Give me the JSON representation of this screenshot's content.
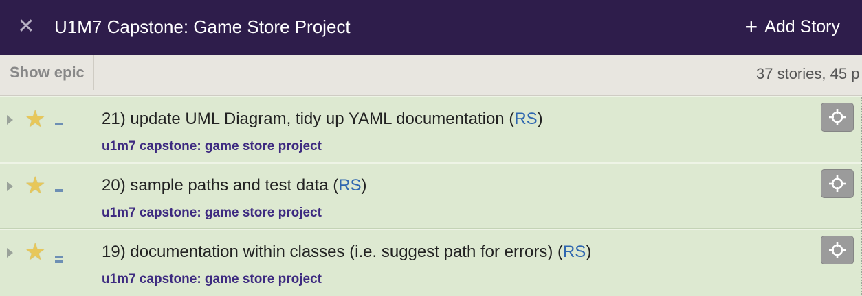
{
  "header": {
    "close_icon": "✕",
    "title": "U1M7 Capstone: Game Store Project",
    "add_story_icon": "+",
    "add_story_label": "Add Story"
  },
  "toolbar": {
    "show_epic_label": "Show epic",
    "counts_text": "37 stories, 45 p"
  },
  "stories": [
    {
      "title": "21) update UML Diagram, tidy up YAML documentation (",
      "owner": "RS",
      "close_paren": ")",
      "label": "u1m7 capstone: game store project",
      "estimate_points": 1
    },
    {
      "title": "20) sample paths and test data (",
      "owner": "RS",
      "close_paren": ")",
      "label": "u1m7 capstone: game store project",
      "estimate_points": 1
    },
    {
      "title": "19) documentation within classes (i.e. suggest path for errors) (",
      "owner": "RS",
      "close_paren": ")",
      "label": "u1m7 capstone: game store project",
      "estimate_points": 2
    }
  ],
  "colors": {
    "header_bg": "#2e1d4b",
    "story_bg": "#dde9d1",
    "label_color": "#3d2a80",
    "owner_link": "#2f67b0",
    "star": "#e7c75a"
  }
}
